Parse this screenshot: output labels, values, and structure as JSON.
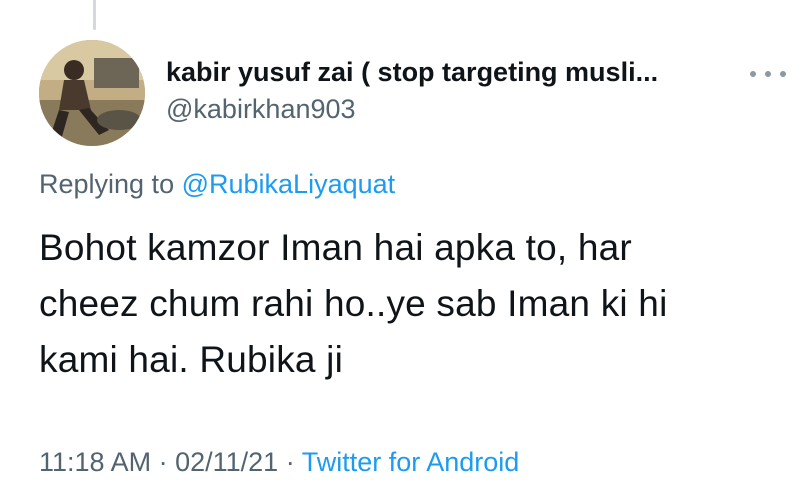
{
  "author": {
    "display_name": "kabir yusuf zai ( stop targeting musli...",
    "handle": "@kabirkhan903"
  },
  "reply": {
    "prefix": "Replying to ",
    "mention": "@RubikaLiyaquat"
  },
  "tweet": {
    "lines": [
      "Bohot kamzor Iman hai apka to, har",
      "cheez chum rahi ho..ye sab Iman ki hi",
      "kami hai. Rubika ji"
    ]
  },
  "meta": {
    "time": "11:18 AM",
    "separator": " · ",
    "date": "02/11/21",
    "source": "Twitter for Android"
  },
  "icons": {
    "more": "more-horizontal-icon"
  },
  "colors": {
    "text": "#0f1419",
    "secondary": "#536471",
    "link": "#1d9bf0"
  }
}
